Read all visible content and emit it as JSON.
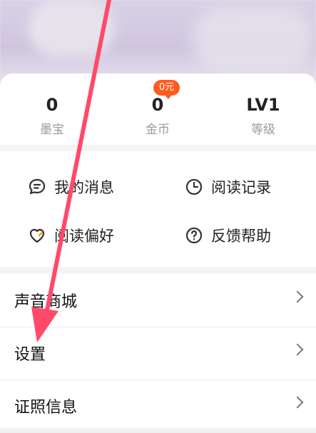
{
  "stats": [
    {
      "value": "0",
      "label": "墨宝"
    },
    {
      "value": "0",
      "label": "金币"
    },
    {
      "value": "LV1",
      "label": "等级"
    }
  ],
  "badge": "0元",
  "grid": [
    {
      "label": "我的消息",
      "icon": "message-icon"
    },
    {
      "label": "阅读记录",
      "icon": "clock-icon"
    },
    {
      "label": "阅读偏好",
      "icon": "heart-icon"
    },
    {
      "label": "反馈帮助",
      "icon": "help-icon"
    }
  ],
  "list": [
    {
      "label": "声音商城"
    },
    {
      "label": "设置"
    },
    {
      "label": "证照信息"
    }
  ],
  "annotation": {
    "color": "#ff4a6a"
  }
}
